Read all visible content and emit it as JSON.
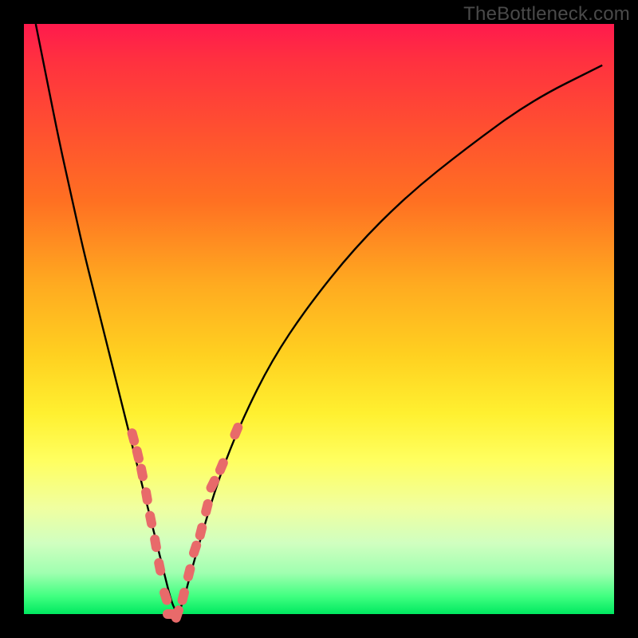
{
  "watermark": "TheBottleneck.com",
  "chart_data": {
    "type": "line",
    "title": "",
    "xlabel": "",
    "ylabel": "",
    "xlim": [
      0,
      100
    ],
    "ylim": [
      0,
      100
    ],
    "grid": false,
    "legend": "none",
    "series": [
      {
        "name": "bottleneck-curve",
        "color": "#000000",
        "x": [
          2,
          4,
          6,
          8,
          10,
          12,
          14,
          16,
          18,
          20,
          21.5,
          23,
          24,
          25,
          26,
          27,
          28,
          30,
          33,
          37,
          42,
          48,
          56,
          65,
          75,
          86,
          98
        ],
        "values": [
          100,
          90,
          80,
          71,
          62,
          54,
          46,
          38,
          30,
          22,
          16,
          10,
          6,
          2,
          0,
          2,
          6,
          13,
          23,
          33,
          43,
          52,
          62,
          71,
          79,
          87,
          93
        ]
      }
    ],
    "annotations": [
      {
        "type": "marker-cluster",
        "shape": "rounded-capsule",
        "color": "#e86a6a",
        "points": [
          {
            "x": 18.5,
            "y": 30
          },
          {
            "x": 19.3,
            "y": 27
          },
          {
            "x": 20,
            "y": 24
          },
          {
            "x": 20.8,
            "y": 20
          },
          {
            "x": 21.5,
            "y": 16
          },
          {
            "x": 22.3,
            "y": 12
          },
          {
            "x": 23,
            "y": 8
          },
          {
            "x": 24,
            "y": 3
          },
          {
            "x": 25,
            "y": 0
          },
          {
            "x": 26,
            "y": 0
          },
          {
            "x": 27,
            "y": 3
          },
          {
            "x": 28,
            "y": 7
          },
          {
            "x": 29,
            "y": 11
          },
          {
            "x": 30,
            "y": 14
          },
          {
            "x": 31,
            "y": 18
          },
          {
            "x": 32,
            "y": 22
          },
          {
            "x": 33.5,
            "y": 25
          },
          {
            "x": 36,
            "y": 31
          }
        ]
      }
    ]
  }
}
